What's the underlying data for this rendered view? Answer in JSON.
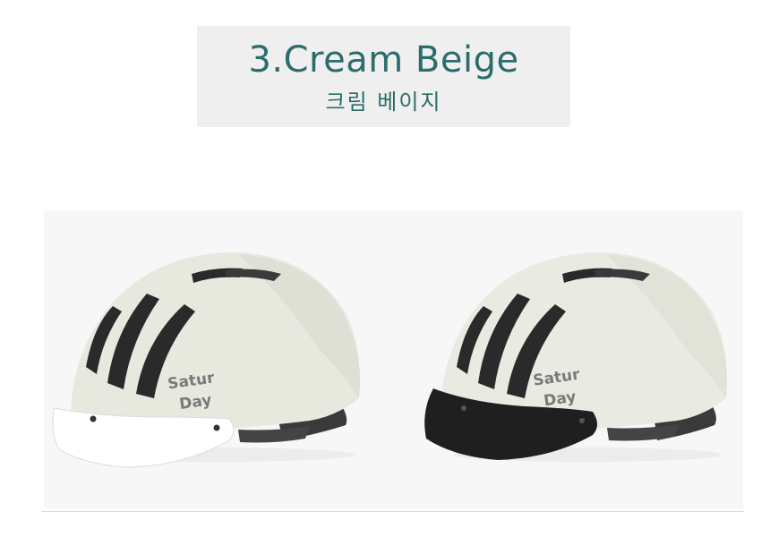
{
  "header": {
    "title": "3.Cream Beige",
    "subtitle": "크림 베이지"
  },
  "products": [
    {
      "logo_text_line1": "Satur",
      "logo_text_line2": "Day",
      "shell_color": "#e7e9df",
      "visor_color": "#ffffff"
    },
    {
      "logo_text_line1": "Satur",
      "logo_text_line2": "Day",
      "shell_color": "#e9ebe2",
      "visor_color": "#1f1f1f"
    }
  ],
  "colors": {
    "title_text": "#2b6d6a",
    "title_background": "#efefef",
    "logo_text": "#7a7a7a"
  }
}
